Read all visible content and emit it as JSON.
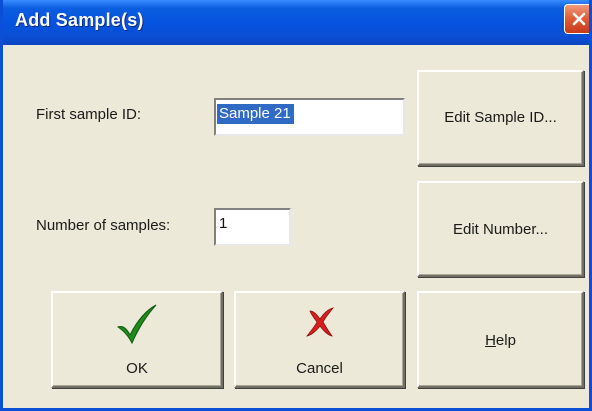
{
  "window": {
    "title": "Add Sample(s)",
    "close_icon": "close-icon"
  },
  "fields": {
    "first_sample_label": "First sample ID:",
    "first_sample_value": "Sample 21",
    "number_label": "Number of samples:",
    "number_value": "1"
  },
  "buttons": {
    "edit_sample_id": "Edit Sample ID...",
    "edit_number": "Edit Number...",
    "ok": "OK",
    "cancel": "Cancel",
    "help": "Help"
  },
  "icons": {
    "ok_icon": "checkmark-icon",
    "cancel_icon": "x-mark-icon",
    "ok_color": "#1e8a1e",
    "cancel_color": "#d81e1e"
  }
}
